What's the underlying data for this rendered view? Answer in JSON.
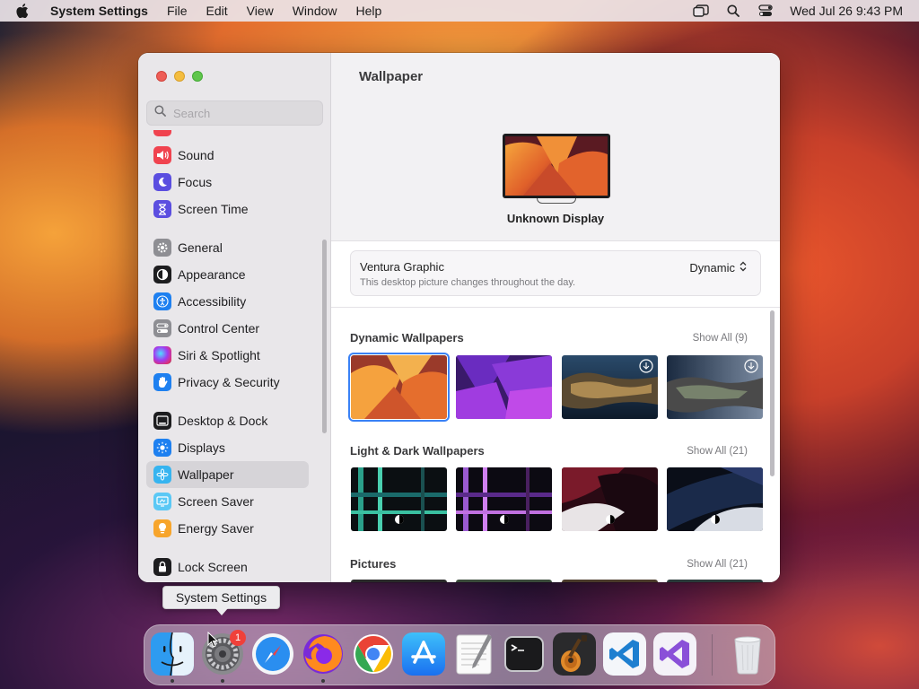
{
  "menubar": {
    "app_name": "System Settings",
    "items": [
      "File",
      "Edit",
      "View",
      "Window",
      "Help"
    ],
    "clock": "Wed Jul 26  9:43 PM"
  },
  "sidebar": {
    "search_placeholder": "Search",
    "items": [
      {
        "label": "Sound",
        "icon": "speaker-icon",
        "color": "#f0434f"
      },
      {
        "label": "Focus",
        "icon": "moon-icon",
        "color": "#5b4ee0"
      },
      {
        "label": "Screen Time",
        "icon": "hourglass-icon",
        "color": "#5b4ee0"
      },
      {
        "label": "General",
        "icon": "gear-icon",
        "color": "#8e8e93"
      },
      {
        "label": "Appearance",
        "icon": "appearance-icon",
        "color": "#1d1d1f"
      },
      {
        "label": "Accessibility",
        "icon": "accessibility-icon",
        "color": "#1e80f0"
      },
      {
        "label": "Control Center",
        "icon": "toggles-icon",
        "color": "#8e8e93"
      },
      {
        "label": "Siri & Spotlight",
        "icon": "siri-icon",
        "color": "#c0269f"
      },
      {
        "label": "Privacy & Security",
        "icon": "hand-icon",
        "color": "#1e80f0"
      },
      {
        "label": "Desktop & Dock",
        "icon": "dock-icon",
        "color": "#1d1d1f"
      },
      {
        "label": "Displays",
        "icon": "sun-icon",
        "color": "#1e80f0"
      },
      {
        "label": "Wallpaper",
        "icon": "flower-icon",
        "color": "#36b4f0"
      },
      {
        "label": "Screen Saver",
        "icon": "screensaver-icon",
        "color": "#5ac8f5"
      },
      {
        "label": "Energy Saver",
        "icon": "bulb-icon",
        "color": "#f7a52c"
      },
      {
        "label": "Lock Screen",
        "icon": "lock-icon",
        "color": "#1d1d1f"
      }
    ],
    "selected": "Wallpaper"
  },
  "main": {
    "title": "Wallpaper",
    "display_name": "Unknown Display",
    "current": {
      "title": "Ventura Graphic",
      "subtitle": "This desktop picture changes throughout the day.",
      "mode": "Dynamic"
    },
    "sections": [
      {
        "title": "Dynamic Wallpapers",
        "show_all": "Show All (9)"
      },
      {
        "title": "Light & Dark Wallpapers",
        "show_all": "Show All (21)"
      },
      {
        "title": "Pictures",
        "show_all": "Show All (21)"
      }
    ]
  },
  "tooltip": "System Settings",
  "dock": {
    "apps": [
      "Finder",
      "System Settings",
      "Safari",
      "Firefox",
      "Chrome",
      "App Store",
      "TextEdit",
      "Terminal",
      "GarageBand",
      "Visual Studio Code",
      "Visual Studio",
      "Trash"
    ],
    "badge": "1"
  }
}
